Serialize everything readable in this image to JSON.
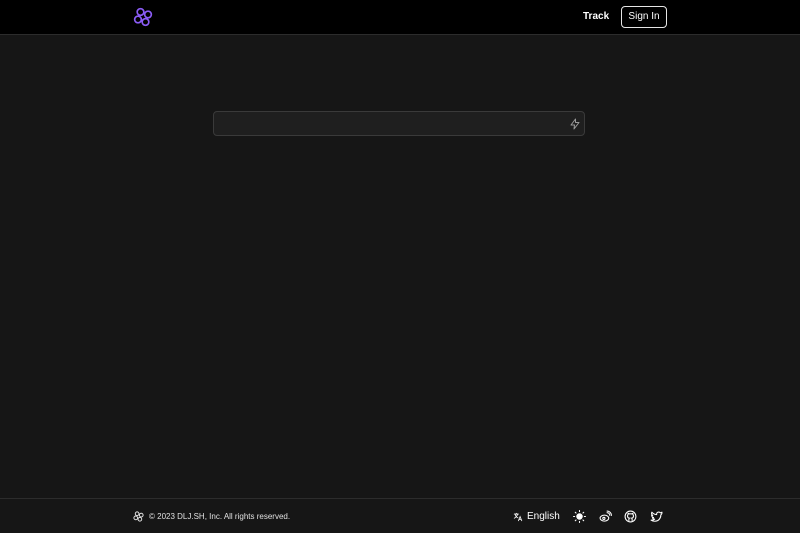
{
  "header": {
    "logo_icon": "dlj-logo-icon",
    "nav_track_label": "Track",
    "signin_label": "Sign In"
  },
  "main": {
    "url_input": {
      "value": "",
      "placeholder": ""
    },
    "submit_icon": "lightning-icon"
  },
  "footer": {
    "logo_icon": "dlj-logo-icon",
    "copyright": "© 2023 DLJ.SH, Inc. All rights reserved.",
    "language_label": "English",
    "icons": [
      "translate-icon",
      "sun-icon",
      "weibo-icon",
      "github-icon",
      "twitter-icon"
    ]
  },
  "colors": {
    "brand": "#8b5cf6",
    "header_bg": "#000000",
    "page_bg": "#161616",
    "input_bg": "#1f1f1f"
  }
}
